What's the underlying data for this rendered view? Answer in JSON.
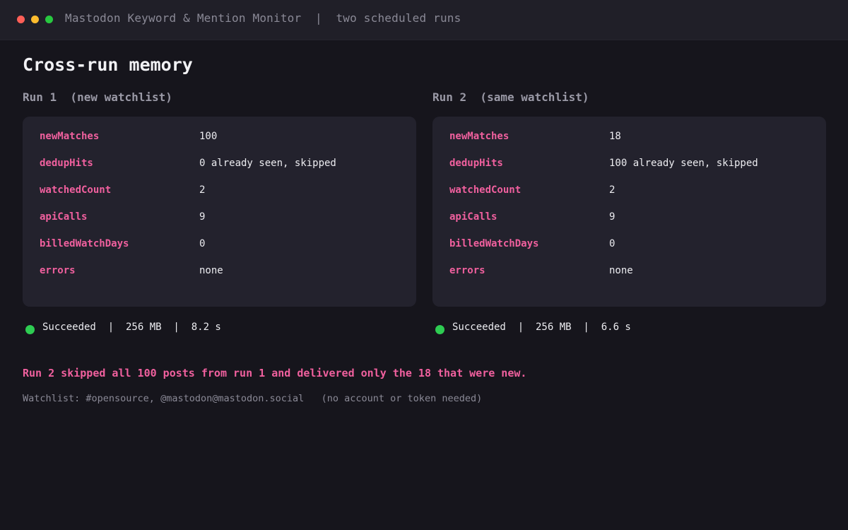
{
  "window": {
    "title": "Mastodon Keyword & Mention Monitor  |  two scheduled runs"
  },
  "page": {
    "heading": "Cross-run memory"
  },
  "runs": [
    {
      "title": "Run 1  (new watchlist)",
      "rows": [
        {
          "key": "newMatches",
          "value": "100"
        },
        {
          "key": "dedupHits",
          "value": "0 already seen, skipped"
        },
        {
          "key": "watchedCount",
          "value": "2"
        },
        {
          "key": "apiCalls",
          "value": "9"
        },
        {
          "key": "billedWatchDays",
          "value": "0"
        },
        {
          "key": "errors",
          "value": "none"
        }
      ],
      "status": "Succeeded  |  256 MB  |  8.2 s",
      "status_color": "#2ecc52"
    },
    {
      "title": "Run 2  (same watchlist)",
      "rows": [
        {
          "key": "newMatches",
          "value": "18"
        },
        {
          "key": "dedupHits",
          "value": "100 already seen, skipped"
        },
        {
          "key": "watchedCount",
          "value": "2"
        },
        {
          "key": "apiCalls",
          "value": "9"
        },
        {
          "key": "billedWatchDays",
          "value": "0"
        },
        {
          "key": "errors",
          "value": "none"
        }
      ],
      "status": "Succeeded  |  256 MB  |  6.6 s",
      "status_color": "#2ecc52"
    }
  ],
  "summary": "Run 2 skipped all 100 posts from run 1 and delivered only the 18 that were new.",
  "footnote": "Watchlist: #opensource, @mastodon@mastodon.social   (no account or token needed)",
  "colors": {
    "accent": "#f0609e",
    "success": "#2ecc52",
    "background": "#16151c",
    "card": "#23222d"
  }
}
